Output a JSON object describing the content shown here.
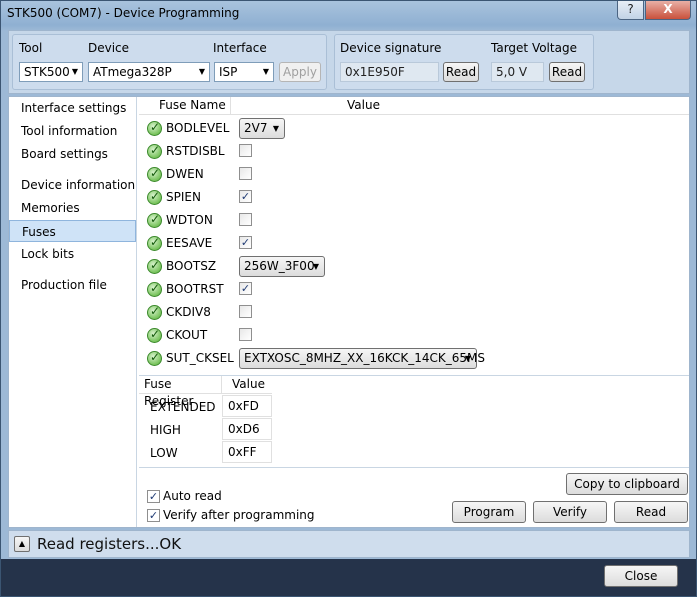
{
  "window": {
    "title": "STK500 (COM7) - Device Programming",
    "help_icon": "?",
    "close_icon": "X"
  },
  "top": {
    "tool_label": "Tool",
    "tool_value": "STK500",
    "device_label": "Device",
    "device_value": "ATmega328P",
    "interface_label": "Interface",
    "interface_value": "ISP",
    "apply_label": "Apply",
    "signature_label": "Device signature",
    "signature_value": "0x1E950F",
    "signature_read": "Read",
    "voltage_label": "Target Voltage",
    "voltage_value": "5,0 V",
    "voltage_read": "Read"
  },
  "sidebar": {
    "items": [
      "Interface settings",
      "Tool information",
      "Board settings",
      "Device information",
      "Memories",
      "Fuses",
      "Lock bits",
      "Production file"
    ],
    "active": "Fuses"
  },
  "fuses": {
    "col_name": "Fuse Name",
    "col_value": "Value",
    "rows": [
      {
        "name": "BODLEVEL",
        "kind": "combo",
        "value": "2V7"
      },
      {
        "name": "RSTDISBL",
        "kind": "check",
        "checked": false
      },
      {
        "name": "DWEN",
        "kind": "check",
        "checked": false
      },
      {
        "name": "SPIEN",
        "kind": "check",
        "checked": true
      },
      {
        "name": "WDTON",
        "kind": "check",
        "checked": false
      },
      {
        "name": "EESAVE",
        "kind": "check",
        "checked": true
      },
      {
        "name": "BOOTSZ",
        "kind": "combo",
        "value": "256W_3F00"
      },
      {
        "name": "BOOTRST",
        "kind": "check",
        "checked": true
      },
      {
        "name": "CKDIV8",
        "kind": "check",
        "checked": false
      },
      {
        "name": "CKOUT",
        "kind": "check",
        "checked": false
      },
      {
        "name": "SUT_CKSEL",
        "kind": "combo",
        "value": "EXTXOSC_8MHZ_XX_16KCK_14CK_65MS"
      }
    ]
  },
  "registers": {
    "col_name": "Fuse Register",
    "col_value": "Value",
    "rows": [
      {
        "name": "EXTENDED",
        "value": "0xFD"
      },
      {
        "name": "HIGH",
        "value": "0xD6"
      },
      {
        "name": "LOW",
        "value": "0xFF"
      }
    ]
  },
  "actions": {
    "copy": "Copy to clipboard",
    "auto_read": "Auto read",
    "auto_read_checked": true,
    "verify_after": "Verify after programming",
    "verify_after_checked": true,
    "program": "Program",
    "verify": "Verify",
    "read": "Read"
  },
  "status": {
    "text": "Read registers...OK"
  },
  "footer": {
    "close": "Close"
  }
}
